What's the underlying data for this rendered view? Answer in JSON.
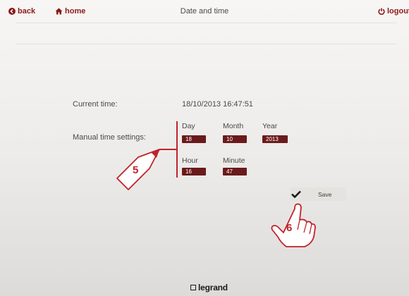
{
  "header": {
    "back_label": "back",
    "home_label": "home",
    "title": "Date and time",
    "logout_label": "logout",
    "accent_color": "#8b1a1a"
  },
  "current_time": {
    "label": "Current time:",
    "value": "18/10/2013 16:47:51"
  },
  "manual": {
    "label": "Manual time settings:",
    "day": {
      "label": "Day",
      "value": "18"
    },
    "month": {
      "label": "Month",
      "value": "10"
    },
    "year": {
      "label": "Year",
      "value": "2013"
    },
    "hour": {
      "label": "Hour",
      "value": "16"
    },
    "minute": {
      "label": "Minute",
      "value": "47"
    }
  },
  "save": {
    "label": "Save",
    "icon": "check-icon"
  },
  "callouts": {
    "step_5": "5",
    "step_6": "6",
    "color": "#c0232a"
  },
  "footer": {
    "brand": "legrand"
  }
}
